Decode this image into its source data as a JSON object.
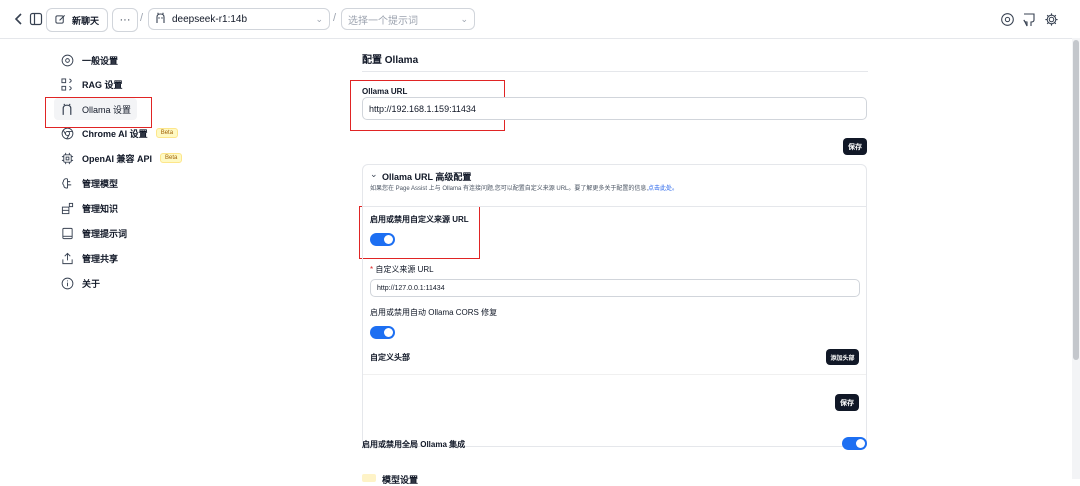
{
  "topbar": {
    "new_chat_label": "新聊天",
    "more_label": "···",
    "model_value": "deepseek-r1:14b",
    "prompt_placeholder": "选择一个提示词",
    "separator": "/"
  },
  "sidebar": {
    "items": [
      {
        "label": "一般设置",
        "icon": "gear-circle-icon"
      },
      {
        "label": "RAG 设置",
        "icon": "rag-icon"
      },
      {
        "label": "Ollama 设置",
        "icon": "ollama-icon"
      },
      {
        "label": "Chrome AI 设置",
        "icon": "chrome-icon",
        "badge": "Beta"
      },
      {
        "label": "OpenAI 兼容 API",
        "icon": "cpu-icon",
        "badge": "Beta"
      },
      {
        "label": "管理模型",
        "icon": "brain-icon"
      },
      {
        "label": "管理知识",
        "icon": "blocks-icon"
      },
      {
        "label": "管理提示词",
        "icon": "book-icon"
      },
      {
        "label": "管理共享",
        "icon": "share-icon"
      },
      {
        "label": "关于",
        "icon": "info-icon"
      }
    ]
  },
  "main": {
    "title": "配置 Ollama",
    "ollama_url_label": "Ollama URL",
    "ollama_url_value": "http://192.168.1.159:11434",
    "save_label": "保存",
    "advanced": {
      "title": "Ollama URL 高级配置",
      "description": "如果您在 Page Assist 上与 Ollama 有连接问题,您可以配置自定义来源 URL。要了解更多关于配置的信息,",
      "link_text": "点击此处。",
      "custom_origin_toggle_label": "启用或禁用自定义来源 URL",
      "custom_origin_required": "*",
      "custom_origin_label": "自定义来源 URL",
      "custom_origin_value": "http://127.0.0.1:11434",
      "cors_toggle_label": "启用或禁用自动 Ollama CORS 修复",
      "custom_headers_label": "自定义头部",
      "add_header_label": "添加头部",
      "save_label": "保存"
    },
    "global_toggle_label": "启用或禁用全局 Ollama 集成",
    "model_settings_title": "模型设置"
  },
  "colors": {
    "accent": "#1d6ff2",
    "highlight_box": "#e02424",
    "dark_button": "#111827"
  }
}
